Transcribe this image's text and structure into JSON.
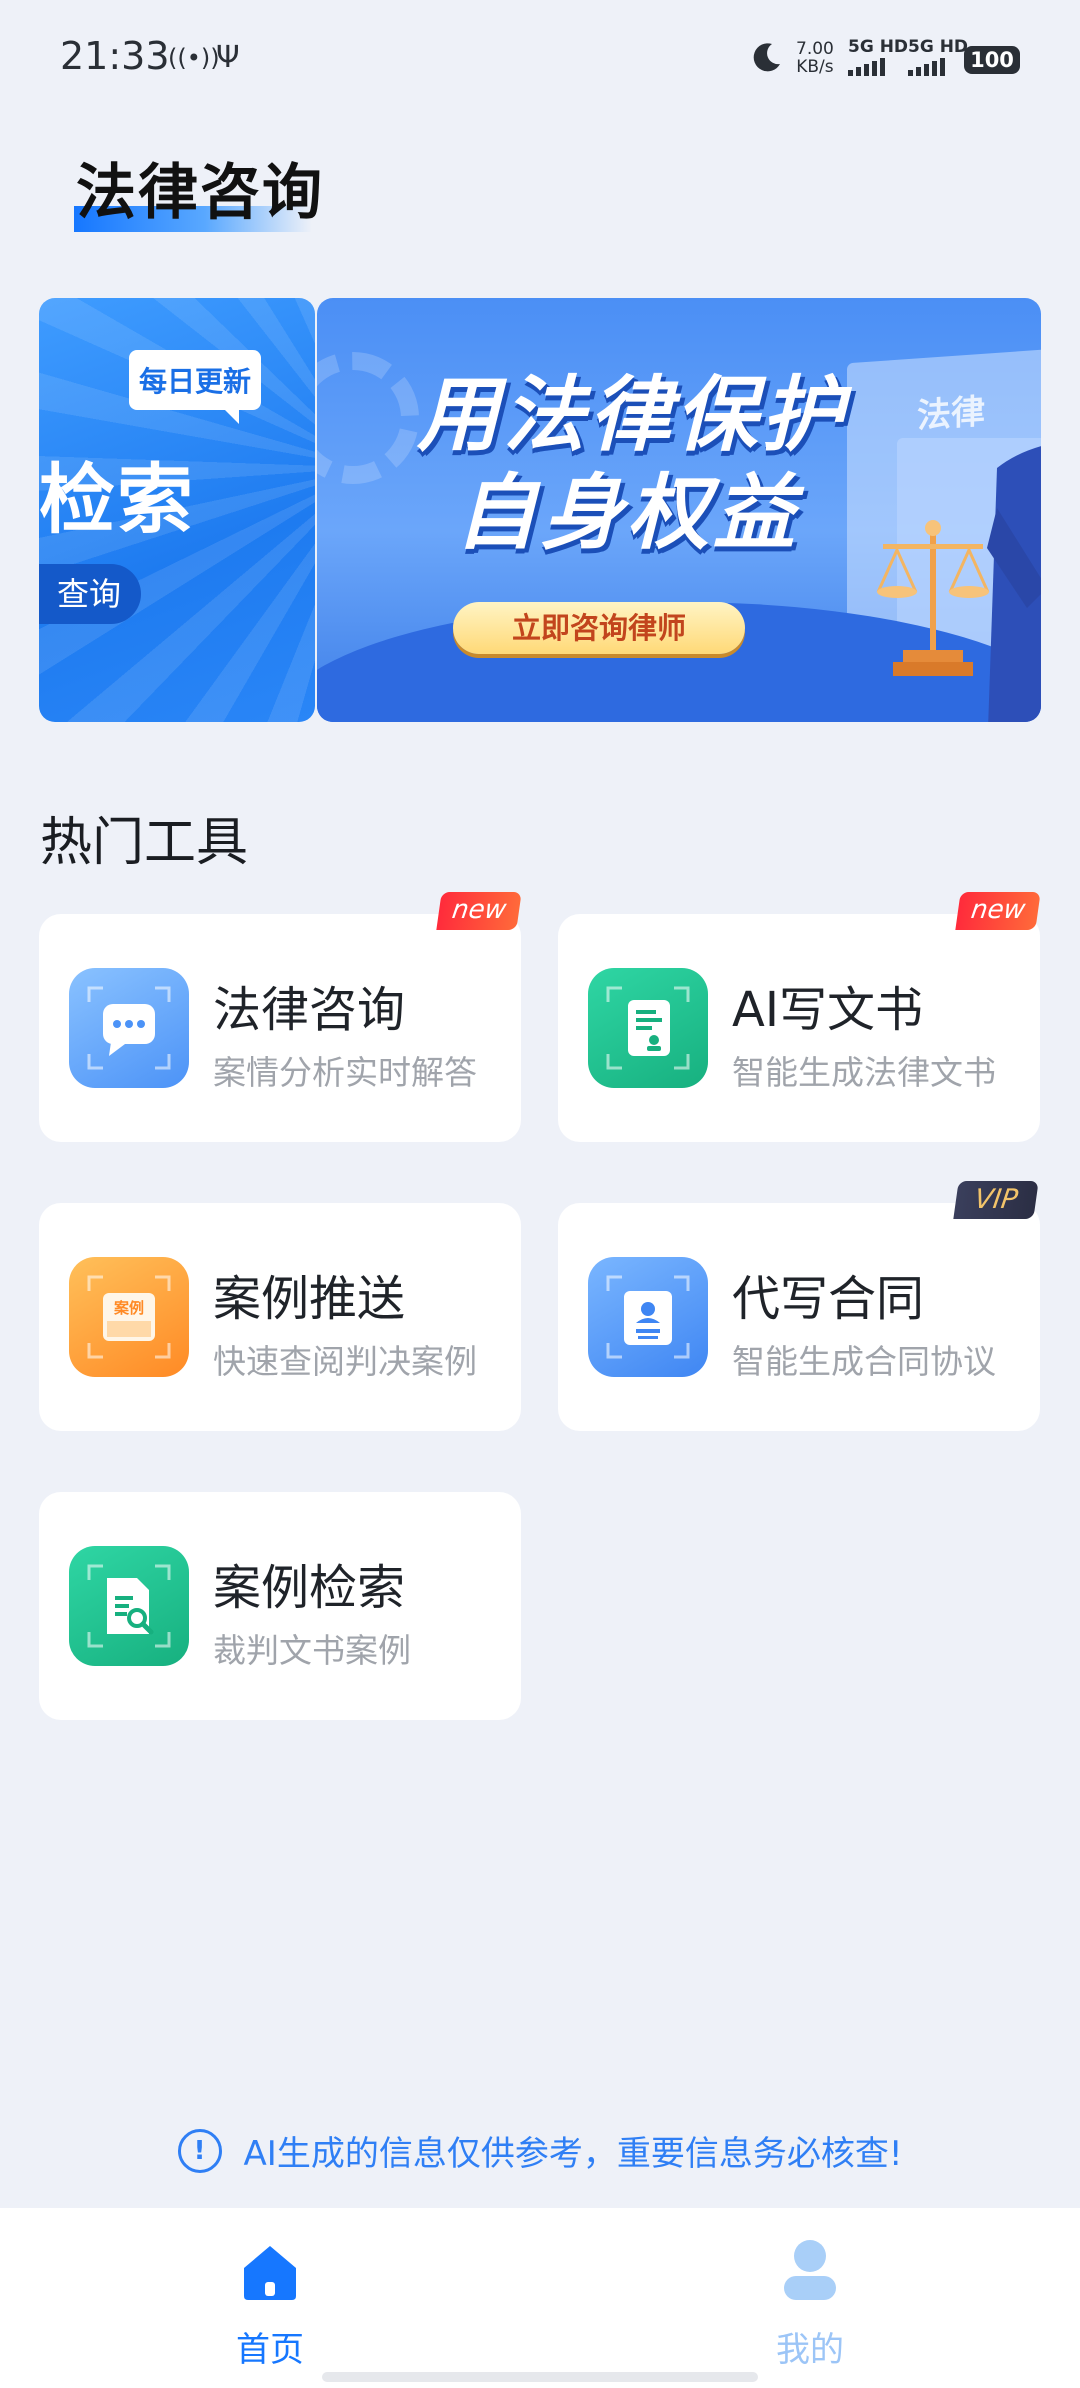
{
  "status_bar": {
    "time": "21:33",
    "signal_symbol": "((•))",
    "usb_symbol": "Ψ",
    "speed_value": "7.00",
    "speed_unit": "KB/s",
    "net1": "5G HD",
    "net2": "5G HD",
    "battery": "100"
  },
  "page": {
    "title": "法律咨询"
  },
  "banner": {
    "left_badge": "每日更新",
    "left_big_text": "检索",
    "left_button": "查询",
    "main_line1": "用法律保护",
    "main_line2": "自身权益",
    "main_cta": "立即咨询律师",
    "board_text": "法律"
  },
  "section": {
    "title": "热门工具"
  },
  "tools": [
    {
      "name": "法律咨询",
      "desc": "案情分析实时解答",
      "tag": "new",
      "icon": "chat-bubble-icon"
    },
    {
      "name": "AI写文书",
      "desc": "智能生成法律文书",
      "tag": "new",
      "icon": "document-icon"
    },
    {
      "name": "案例推送",
      "desc": "快速查阅判决案例",
      "tag": "",
      "icon": "case-icon",
      "icon_text": "案例"
    },
    {
      "name": "代写合同",
      "desc": "智能生成合同协议",
      "tag": "VIP",
      "icon": "contract-icon"
    },
    {
      "name": "案例检索",
      "desc": "裁判文书案例",
      "tag": "",
      "icon": "search-document-icon"
    }
  ],
  "notice": {
    "icon": "!",
    "text": "AI生成的信息仅供参考，重要信息务必核查!"
  },
  "tabbar": {
    "home": {
      "label": "首页",
      "color": "#1677ff",
      "icon": "home-icon"
    },
    "mine": {
      "label": "我的",
      "color": "#9cc5f7",
      "icon": "user-icon"
    }
  },
  "colors": {
    "accent": "#1677ff",
    "new_tag": "#ff2b3b",
    "vip_tag": "#2b2e44"
  }
}
